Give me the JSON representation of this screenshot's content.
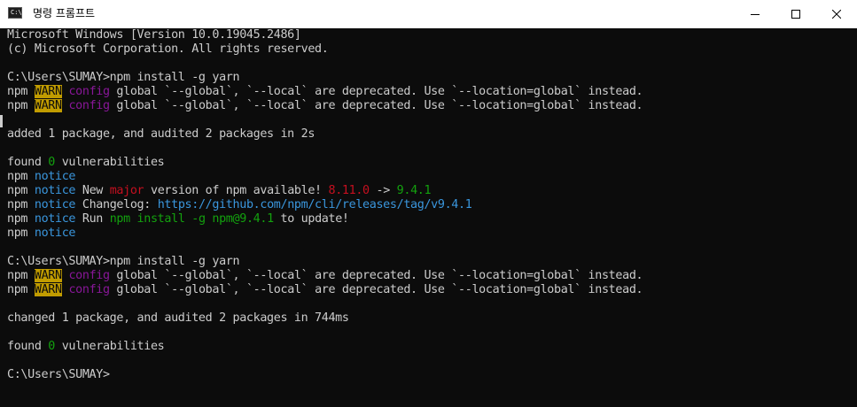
{
  "titlebar": {
    "title": "명령 프롬프트",
    "icon_name": "terminal-icon",
    "icon_text": "C:\\"
  },
  "colors": {
    "background": "#0c0c0c",
    "text": "#cccccc",
    "warn_bg": "#c19c00",
    "magenta": "#881798",
    "blue": "#3a96dd",
    "red": "#c50f1f",
    "green": "#13a10e"
  },
  "console": {
    "lines": [
      [
        {
          "t": "Microsoft Windows [Version 10.0.19045.2486]"
        }
      ],
      [
        {
          "t": "(c) Microsoft Corporation. All rights reserved."
        }
      ],
      [
        {
          "t": ""
        }
      ],
      [
        {
          "t": "C:\\Users\\SUMAY>npm install -g yarn"
        }
      ],
      [
        {
          "t": "npm "
        },
        {
          "t": "WARN",
          "c": "warn"
        },
        {
          "t": " "
        },
        {
          "t": "config",
          "c": "magenta"
        },
        {
          "t": " global `--global`, `--local` are deprecated. Use `--location=global` instead."
        }
      ],
      [
        {
          "t": "npm "
        },
        {
          "t": "WARN",
          "c": "warn"
        },
        {
          "t": " "
        },
        {
          "t": "config",
          "c": "magenta"
        },
        {
          "t": " global `--global`, `--local` are deprecated. Use `--location=global` instead."
        }
      ],
      [
        {
          "t": ""
        }
      ],
      [
        {
          "t": "added 1 package, and audited 2 packages in 2s"
        }
      ],
      [
        {
          "t": ""
        }
      ],
      [
        {
          "t": "found "
        },
        {
          "t": "0",
          "c": "green"
        },
        {
          "t": " vulnerabilities"
        }
      ],
      [
        {
          "t": "npm "
        },
        {
          "t": "notice",
          "c": "blue"
        }
      ],
      [
        {
          "t": "npm "
        },
        {
          "t": "notice",
          "c": "blue"
        },
        {
          "t": " New "
        },
        {
          "t": "major",
          "c": "red"
        },
        {
          "t": " version of npm available! "
        },
        {
          "t": "8.11.0",
          "c": "red"
        },
        {
          "t": " -> "
        },
        {
          "t": "9.4.1",
          "c": "green"
        }
      ],
      [
        {
          "t": "npm "
        },
        {
          "t": "notice",
          "c": "blue"
        },
        {
          "t": " Changelog: "
        },
        {
          "t": "https://github.com/npm/cli/releases/tag/v9.4.1",
          "c": "blue"
        }
      ],
      [
        {
          "t": "npm "
        },
        {
          "t": "notice",
          "c": "blue"
        },
        {
          "t": " Run "
        },
        {
          "t": "npm install -g npm@9.4.1",
          "c": "green"
        },
        {
          "t": " to update!"
        }
      ],
      [
        {
          "t": "npm "
        },
        {
          "t": "notice",
          "c": "blue"
        }
      ],
      [
        {
          "t": ""
        }
      ],
      [
        {
          "t": "C:\\Users\\SUMAY>npm install -g yarn"
        }
      ],
      [
        {
          "t": "npm "
        },
        {
          "t": "WARN",
          "c": "warn"
        },
        {
          "t": " "
        },
        {
          "t": "config",
          "c": "magenta"
        },
        {
          "t": " global `--global`, `--local` are deprecated. Use `--location=global` instead."
        }
      ],
      [
        {
          "t": "npm "
        },
        {
          "t": "WARN",
          "c": "warn"
        },
        {
          "t": " "
        },
        {
          "t": "config",
          "c": "magenta"
        },
        {
          "t": " global `--global`, `--local` are deprecated. Use `--location=global` instead."
        }
      ],
      [
        {
          "t": ""
        }
      ],
      [
        {
          "t": "changed 1 package, and audited 2 packages in 744ms"
        }
      ],
      [
        {
          "t": ""
        }
      ],
      [
        {
          "t": "found "
        },
        {
          "t": "0",
          "c": "green"
        },
        {
          "t": " vulnerabilities"
        }
      ],
      [
        {
          "t": ""
        }
      ],
      [
        {
          "t": "C:\\Users\\SUMAY>"
        }
      ]
    ]
  }
}
